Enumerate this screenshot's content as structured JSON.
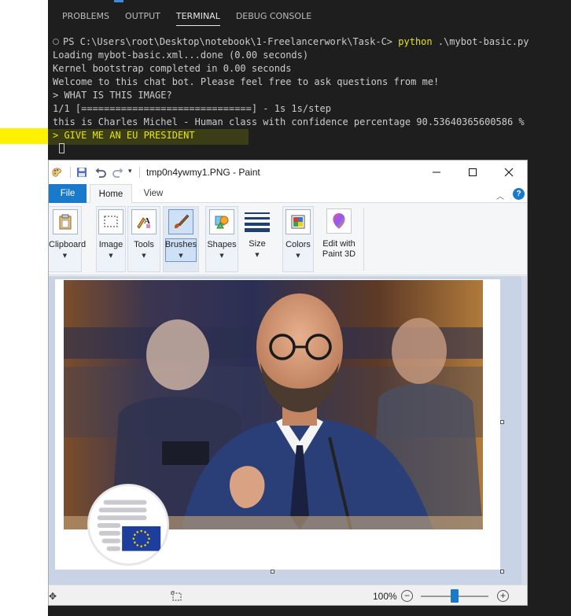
{
  "terminal": {
    "tabs": [
      "PROBLEMS",
      "OUTPUT",
      "TERMINAL",
      "DEBUG CONSOLE"
    ],
    "active_tab": "TERMINAL",
    "prompt_path": "PS C:\\Users\\root\\Desktop\\notebook\\1-Freelancerwork\\Task-C>",
    "command": "python",
    "command_arg": ".\\mybot-basic.py",
    "lines": [
      "Loading mybot-basic.xml...done (0.00 seconds)",
      "Kernel bootstrap completed in 0.00 seconds",
      "Welcome to this chat bot. Please feel free to ask questions from me!",
      "> WHAT IS THIS IMAGE?",
      "1/1 [==============================] - 1s 1s/step",
      "this is Charles Michel - Human class with confidence percentage 90.53640365600586 %"
    ],
    "highlight_line": "> GIVE ME AN EU PRESIDENT",
    "colors": {
      "background": "#1e1e1e",
      "text": "#cccccc",
      "command": "#e5e510",
      "marker": "#fff200"
    }
  },
  "paint": {
    "window_title": "tmp0n4ywmy1.PNG - Paint",
    "ribbon_tabs": {
      "file": "File",
      "home": "Home",
      "view": "View"
    },
    "groups": {
      "clipboard": "Clipboard",
      "image": "Image",
      "tools": "Tools",
      "brushes": "Brushes",
      "shapes": "Shapes",
      "size": "Size",
      "colors": "Colors",
      "edit3d_line1": "Edit with",
      "edit3d_line2": "Paint 3D"
    },
    "status": {
      "zoom": "100%",
      "zoom_level_fraction": 0.5
    },
    "colors": {
      "file_tab": "#1979ca",
      "canvas_bg": "#c8d3e5",
      "eu_flag": "#1e3e9e",
      "eu_stars": "#f5d000"
    }
  }
}
